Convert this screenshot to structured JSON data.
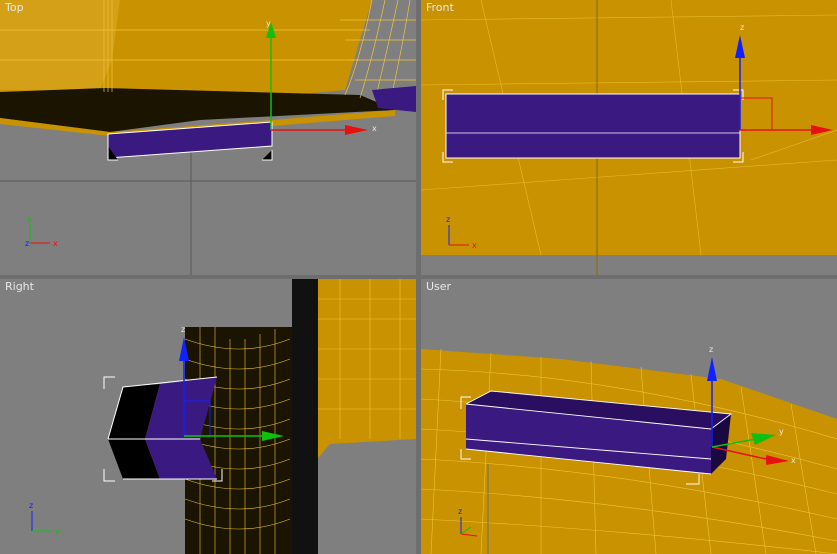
{
  "viewports": {
    "top": {
      "label": "Top"
    },
    "front": {
      "label": "Front"
    },
    "right": {
      "label": "Right"
    },
    "user": {
      "label": "User"
    }
  },
  "axes": {
    "x": "x",
    "y": "y",
    "z": "z"
  },
  "colors": {
    "viewport_bg": "#7f7f7f",
    "mesh_fill": "#c89200",
    "mesh_wire": "#f0c43a",
    "box_fill": "#3a1a80",
    "active_border": "#f5e000",
    "gizmo_x": "#e81010",
    "gizmo_y": "#10c010",
    "gizmo_z": "#1020ff"
  }
}
